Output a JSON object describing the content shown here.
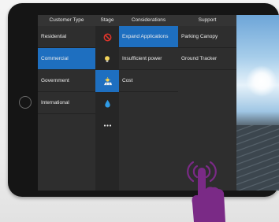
{
  "headers": {
    "customer_type": "Customer Type",
    "stage": "Stage",
    "considerations": "Considerations",
    "support": "Support"
  },
  "customer_types": [
    "Residential",
    "Commercial",
    "Government",
    "International"
  ],
  "selected_customer_type": "Commercial",
  "stage_icons": [
    "no-entry-icon",
    "lightbulb-icon",
    "solar-panel-sun-icon",
    "water-drop-icon",
    "more-dots-icon"
  ],
  "selected_stage_icon": "solar-panel-sun-icon",
  "considerations": [
    "Expand Applications",
    "Insufficient power",
    "Cost"
  ],
  "selected_consideration": "Expand Applications",
  "support": [
    "Parking Canopy",
    "Ground Tracker"
  ],
  "colors": {
    "selected_blue": "#1e6fc0",
    "panel_dark": "#2e2e2e",
    "hand_purple": "#7a2a86"
  }
}
